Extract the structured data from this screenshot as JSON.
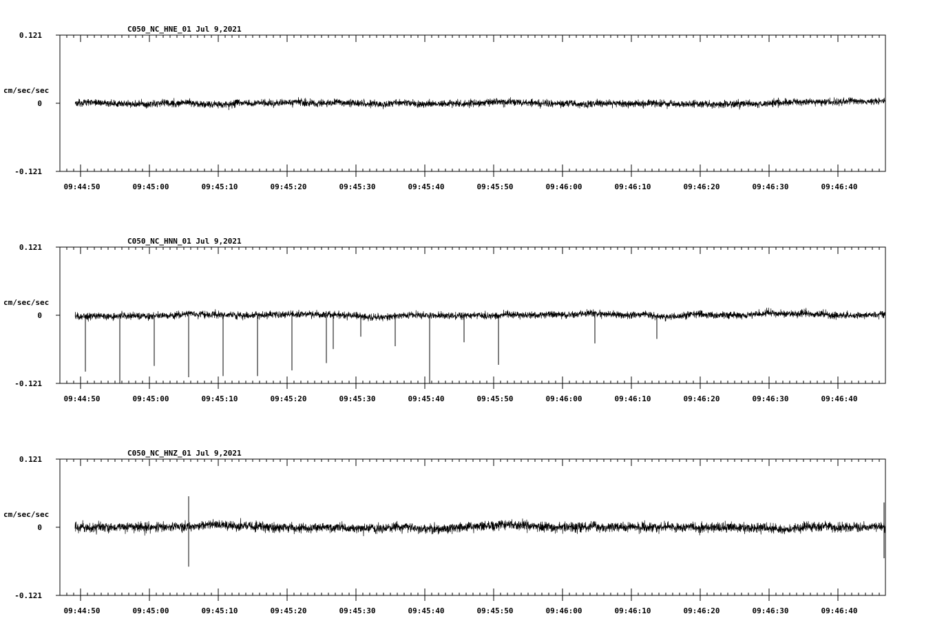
{
  "chart_data": [
    {
      "type": "line",
      "title": "C050_NC_HNE_01   Jul 9,2021",
      "ylabel": "cm/sec/sec",
      "ylim": [
        -0.121,
        0.121
      ],
      "ytick_labels": [
        "0.121",
        "0",
        "-0.121"
      ],
      "xtick_labels": [
        "09:44:50",
        "09:45:00",
        "09:45:10",
        "09:45:20",
        "09:45:30",
        "09:45:40",
        "09:45:50",
        "09:46:00",
        "09:46:10",
        "09:46:20",
        "09:46:30",
        "09:46:40"
      ],
      "trace": {
        "start": "09:44:49",
        "end": "09:46:47",
        "noise_amplitude": 0.012,
        "spikes": []
      }
    },
    {
      "type": "line",
      "title": "C050_NC_HNN_01   Jul 9,2021",
      "ylabel": "cm/sec/sec",
      "ylim": [
        -0.121,
        0.121
      ],
      "ytick_labels": [
        "0.121",
        "0",
        "-0.121"
      ],
      "xtick_labels": [
        "09:44:50",
        "09:45:00",
        "09:45:10",
        "09:45:20",
        "09:45:30",
        "09:45:40",
        "09:45:50",
        "09:46:00",
        "09:46:10",
        "09:46:20",
        "09:46:30",
        "09:46:40"
      ],
      "trace": {
        "start": "09:44:49",
        "end": "09:46:47",
        "noise_amplitude": 0.012,
        "spikes": [
          {
            "t": "09:44:50",
            "value": -0.1
          },
          {
            "t": "09:44:55",
            "value": -0.121
          },
          {
            "t": "09:45:00",
            "value": -0.09
          },
          {
            "t": "09:45:05",
            "value": -0.11
          },
          {
            "t": "09:45:10",
            "value": -0.108
          },
          {
            "t": "09:45:15",
            "value": -0.108
          },
          {
            "t": "09:45:20",
            "value": -0.098
          },
          {
            "t": "09:45:25",
            "value": -0.085
          },
          {
            "t": "09:45:26",
            "value": -0.06
          },
          {
            "t": "09:45:30",
            "value": -0.038
          },
          {
            "t": "09:45:35",
            "value": -0.055
          },
          {
            "t": "09:45:40",
            "value": -0.121
          },
          {
            "t": "09:45:45",
            "value": -0.048
          },
          {
            "t": "09:45:50",
            "value": -0.088
          },
          {
            "t": "09:46:04",
            "value": -0.05
          },
          {
            "t": "09:46:13",
            "value": -0.042
          }
        ]
      }
    },
    {
      "type": "line",
      "title": "C050_NC_HNZ_01   Jul 9,2021",
      "ylabel": "cm/sec/sec",
      "ylim": [
        -0.121,
        0.121
      ],
      "ytick_labels": [
        "0.121",
        "0",
        "-0.121"
      ],
      "xtick_labels": [
        "09:44:50",
        "09:45:00",
        "09:45:10",
        "09:45:20",
        "09:45:30",
        "09:45:40",
        "09:45:50",
        "09:46:00",
        "09:46:10",
        "09:46:20",
        "09:46:30",
        "09:46:40"
      ],
      "trace": {
        "start": "09:44:49",
        "end": "09:46:47",
        "noise_amplitude": 0.016,
        "spikes": [
          {
            "t": "09:45:05",
            "value": 0.055
          },
          {
            "t": "09:45:05",
            "value": -0.07
          },
          {
            "t": "09:46:46",
            "value": 0.044
          },
          {
            "t": "09:46:46",
            "value": -0.055
          }
        ]
      }
    }
  ]
}
